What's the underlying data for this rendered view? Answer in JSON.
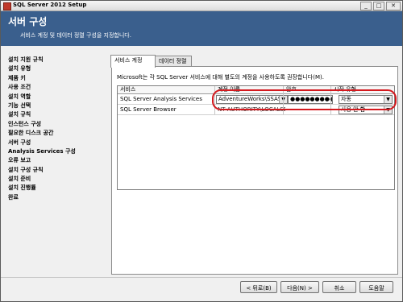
{
  "window": {
    "title": "SQL Server 2012 Setup",
    "min": "_",
    "max": "□",
    "close": "✕"
  },
  "header": {
    "title": "서버 구성",
    "subtitle": "서비스 계정 및 데이터 정렬 구성을 지정합니다."
  },
  "nav": [
    "설치 지원 규칙",
    "설치 유형",
    "제품 키",
    "사용 조건",
    "설치 역할",
    "기능 선택",
    "설치 규칙",
    "인스턴스 구성",
    "필요한 디스크 공간",
    "서버 구성",
    "Analysis Services 구성",
    "오류 보고",
    "설치 구성 규칙",
    "설치 준비",
    "설치 진행률",
    "완료"
  ],
  "tabs": [
    "서비스 계정",
    "데이터 정렬"
  ],
  "panel": {
    "description": "Microsoft는 각 SQL Server 서비스에 대해 별도의 계정을 사용하도록 권장합니다(M)."
  },
  "grid": {
    "columns": [
      "서비스",
      "계정 이름",
      "암호",
      "시작 유형"
    ],
    "rows": [
      {
        "service": "SQL Server Analysis Services",
        "account": "AdventureWorks\\SSAS",
        "password": "●●●●●●●●●",
        "startup": "자동"
      },
      {
        "service": "SQL Server Browser",
        "account": "NT AUTHORITY\\LOCALSE...",
        "password": "",
        "startup": "사용 안 함"
      }
    ]
  },
  "buttons": {
    "back": "< 뒤로(B)",
    "next": "다음(N) >",
    "cancel": "취소",
    "help": "도움말"
  },
  "colors": {
    "header": "#3a5f8d",
    "highlight": "#d4191e"
  }
}
